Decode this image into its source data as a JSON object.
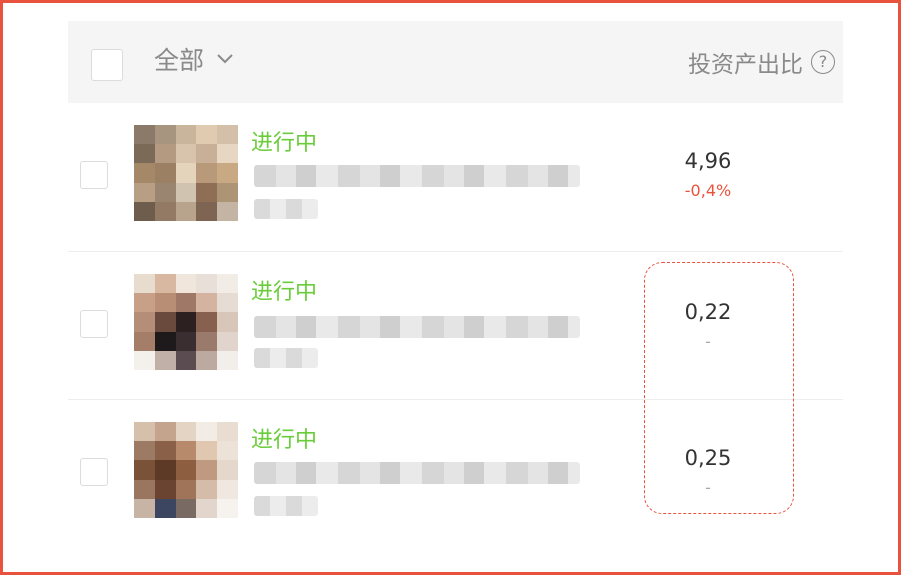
{
  "header": {
    "filter_label": "全部",
    "roi_label": "投资产出比",
    "help_symbol": "?"
  },
  "rows": [
    {
      "status": "进行中",
      "roi": "4,96",
      "change": "-0,4%",
      "change_color": "#e9533e"
    },
    {
      "status": "进行中",
      "roi": "0,22",
      "change": "-",
      "change_color": "#aaaaaa"
    },
    {
      "status": "进行中",
      "roi": "0,25",
      "change": "-",
      "change_color": "#aaaaaa"
    }
  ],
  "colors": {
    "accent": "#e9533e",
    "status_green": "#52c41a"
  }
}
